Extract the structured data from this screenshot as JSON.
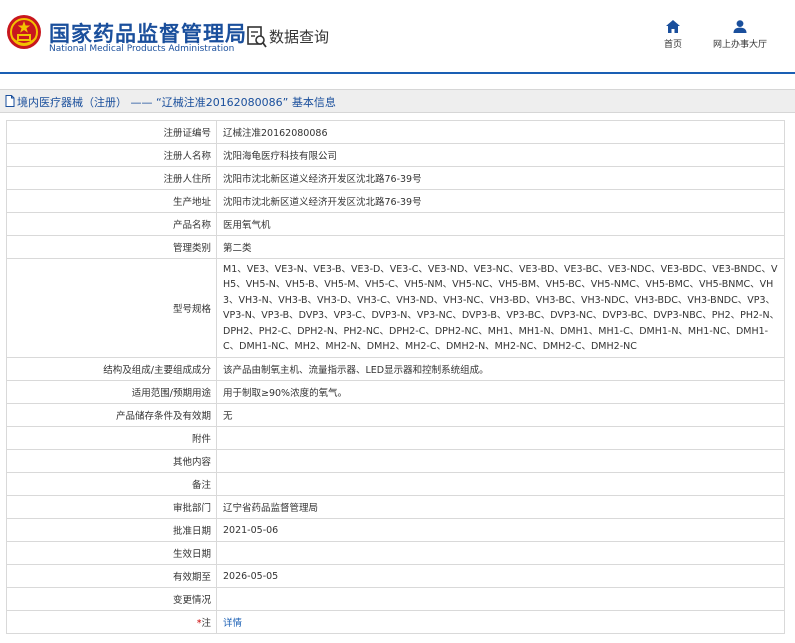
{
  "header": {
    "brand_cn": "国家药品监督管理局",
    "brand_en": "National Medical Products Administration",
    "query_title": "数据查询",
    "nav": {
      "home_label": "首页",
      "hall_label": "网上办事大厅"
    },
    "colors": {
      "brand": "#1a4f9c",
      "emblem_red": "#c8171e",
      "emblem_gold": "#f2c200"
    }
  },
  "titlebar": {
    "text": "境内医疗器械（注册） —— “辽械注准20162080086” 基本信息"
  },
  "rows": [
    {
      "label": "注册证编号",
      "value": "辽械注准20162080086"
    },
    {
      "label": "注册人名称",
      "value": "沈阳海龟医疗科技有限公司"
    },
    {
      "label": "注册人住所",
      "value": "沈阳市沈北新区道义经济开发区沈北路76-39号"
    },
    {
      "label": "生产地址",
      "value": "沈阳市沈北新区道义经济开发区沈北路76-39号"
    },
    {
      "label": "产品名称",
      "value": "医用氧气机"
    },
    {
      "label": "管理类别",
      "value": "第二类"
    },
    {
      "label": "型号规格",
      "value": "M1、VE3、VE3-N、VE3-B、VE3-D、VE3-C、VE3-ND、VE3-NC、VE3-BD、VE3-BC、VE3-NDC、VE3-BDC、VE3-BNDC、VH5、VH5-N、VH5-B、VH5-M、VH5-C、VH5-NM、VH5-NC、VH5-BM、VH5-BC、VH5-NMC、VH5-BMC、VH5-BNMC、VH3、VH3-N、VH3-B、VH3-D、VH3-C、VH3-ND、VH3-NC、VH3-BD、VH3-BC、VH3-NDC、VH3-BDC、VH3-BNDC、VP3、VP3-N、VP3-B、DVP3、VP3-C、DVP3-N、VP3-NC、DVP3-B、VP3-BC、DVP3-NC、DVP3-BC、DVP3-NBC、PH2、PH2-N、DPH2、PH2-C、DPH2-N、PH2-NC、DPH2-C、DPH2-NC、MH1、MH1-N、DMH1、MH1-C、DMH1-N、MH1-NC、DMH1-C、DMH1-NC、MH2、MH2-N、DMH2、MH2-C、DMH2-N、MH2-NC、DMH2-C、DMH2-NC"
    },
    {
      "label": "结构及组成/主要组成成分",
      "value": "该产品由制氧主机、流量指示器、LED显示器和控制系统组成。"
    },
    {
      "label": "适用范围/预期用途",
      "value": "用于制取≥90%浓度的氧气。"
    },
    {
      "label": "产品储存条件及有效期",
      "value": "无"
    },
    {
      "label": "附件",
      "value": ""
    },
    {
      "label": "其他内容",
      "value": ""
    },
    {
      "label": "备注",
      "value": ""
    },
    {
      "label": "审批部门",
      "value": "辽宁省药品监督管理局"
    },
    {
      "label": "批准日期",
      "value": "2021-05-06"
    },
    {
      "label": "生效日期",
      "value": ""
    },
    {
      "label": "有效期至",
      "value": "2026-05-05"
    },
    {
      "label": "变更情况",
      "value": ""
    },
    {
      "label": "注",
      "value": "详情"
    }
  ]
}
